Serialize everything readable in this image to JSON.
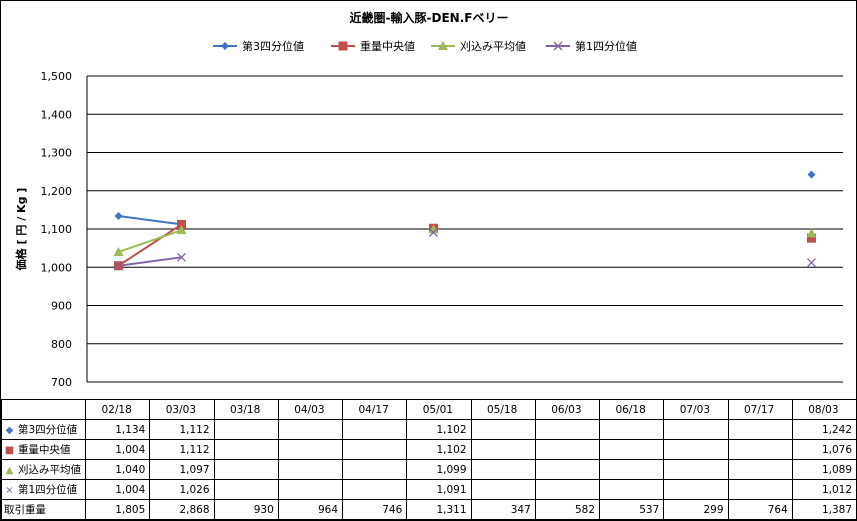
{
  "chart_data": {
    "type": "line",
    "title": "近畿圏-輸入豚-DEN.Fベリー",
    "ylabel": "価格 [ 円 / Kg ]",
    "ylim": [
      700,
      1500
    ],
    "yticks": [
      "700",
      "800",
      "900",
      "1,000",
      "1,100",
      "1,200",
      "1,300",
      "1,400",
      "1,500"
    ],
    "ytick_values": [
      700,
      800,
      900,
      1000,
      1100,
      1200,
      1300,
      1400,
      1500
    ],
    "categories": [
      "02/18",
      "03/03",
      "03/18",
      "04/03",
      "04/17",
      "05/01",
      "05/18",
      "06/03",
      "06/18",
      "07/03",
      "07/17",
      "08/03"
    ],
    "legend_position": "top",
    "grid": true,
    "series": [
      {
        "name": "第3四分位値",
        "color": "#4472C4",
        "marker": "diamond",
        "values": [
          1134,
          1112,
          null,
          null,
          null,
          1102,
          null,
          null,
          null,
          null,
          null,
          1242
        ],
        "labels": [
          "1,134",
          "1,112",
          "",
          "",
          "",
          "1,102",
          "",
          "",
          "",
          "",
          "",
          "1,242"
        ]
      },
      {
        "name": "重量中央値",
        "color": "#C0504D",
        "marker": "square",
        "values": [
          1004,
          1112,
          null,
          null,
          null,
          1102,
          null,
          null,
          null,
          null,
          null,
          1076
        ],
        "labels": [
          "1,004",
          "1,112",
          "",
          "",
          "",
          "1,102",
          "",
          "",
          "",
          "",
          "",
          "1,076"
        ]
      },
      {
        "name": "刈込み平均値",
        "color": "#9BBB59",
        "marker": "triangle",
        "values": [
          1040,
          1097,
          null,
          null,
          null,
          1099,
          null,
          null,
          null,
          null,
          null,
          1089
        ],
        "labels": [
          "1,040",
          "1,097",
          "",
          "",
          "",
          "1,099",
          "",
          "",
          "",
          "",
          "",
          "1,089"
        ]
      },
      {
        "name": "第1四分位値",
        "color": "#8064A2",
        "marker": "x",
        "values": [
          1004,
          1026,
          null,
          null,
          null,
          1091,
          null,
          null,
          null,
          null,
          null,
          1012
        ],
        "labels": [
          "1,004",
          "1,026",
          "",
          "",
          "",
          "1,091",
          "",
          "",
          "",
          "",
          "",
          "1,012"
        ]
      }
    ],
    "volume": {
      "name": "取引重量",
      "labels": [
        "1,805",
        "2,868",
        "930",
        "964",
        "746",
        "1,311",
        "347",
        "582",
        "537",
        "299",
        "764",
        "1,387"
      ]
    }
  }
}
